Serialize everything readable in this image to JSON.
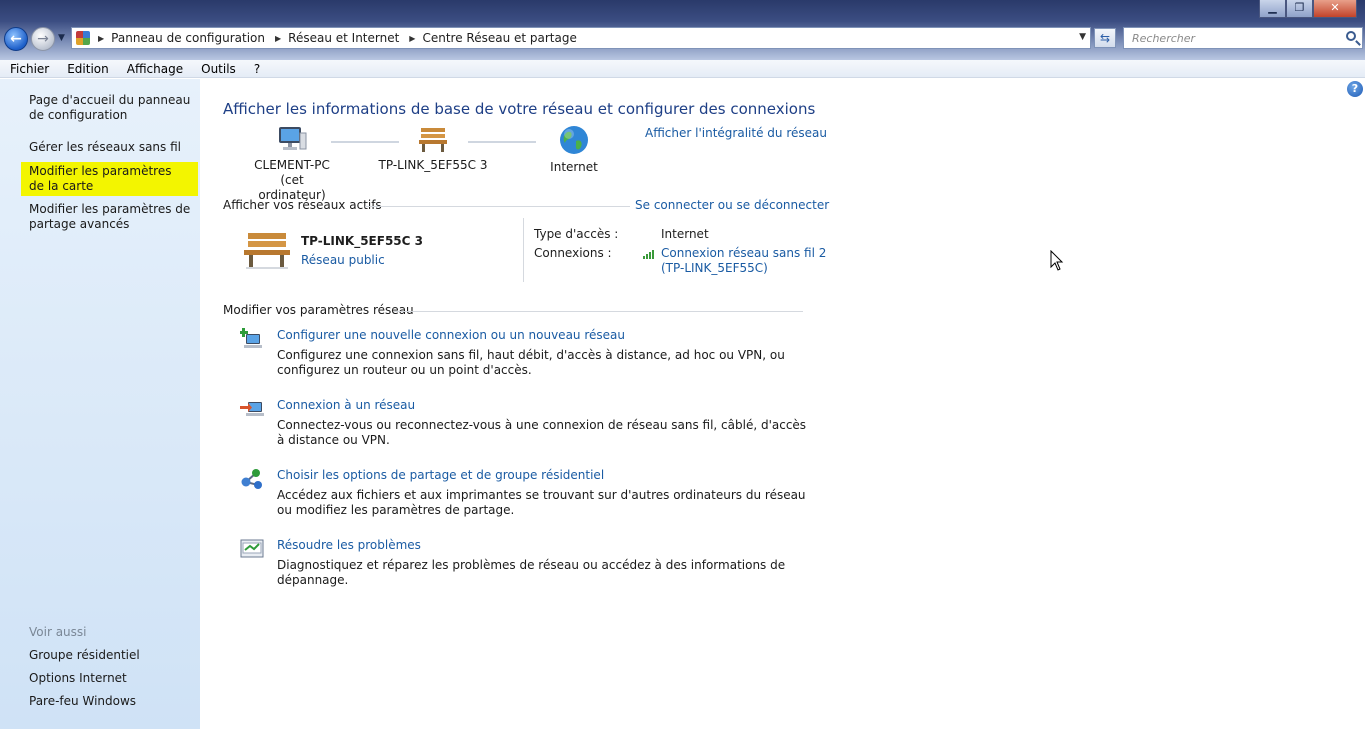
{
  "address": {
    "breadcrumbs": [
      "Panneau de configuration",
      "Réseau et Internet",
      "Centre Réseau et partage"
    ],
    "search_placeholder": "Rechercher"
  },
  "menu": [
    "Fichier",
    "Edition",
    "Affichage",
    "Outils",
    "?"
  ],
  "sidebar": {
    "links": [
      "Page d'accueil du panneau de configuration",
      "Gérer les réseaux sans fil",
      "Modifier les paramètres de la carte",
      "Modifier les paramètres de partage avancés"
    ],
    "see_also_title": "Voir aussi",
    "see_also": [
      "Groupe résidentiel",
      "Options Internet",
      "Pare-feu Windows"
    ]
  },
  "main": {
    "title": "Afficher les informations de base de votre réseau et configurer des connexions",
    "full_map_link": "Afficher l'intégralité du réseau",
    "map": {
      "computer_name": "CLEMENT-PC",
      "computer_sub": "(cet ordinateur)",
      "network_name": "TP-LINK_5EF55C  3",
      "internet": "Internet"
    },
    "active_networks_title": "Afficher vos réseaux actifs",
    "connect_link": "Se connecter ou se déconnecter",
    "active": {
      "name": "TP-LINK_5EF55C  3",
      "type": "Réseau public",
      "access_label": "Type d'accès :",
      "access_value": "Internet",
      "connections_label": "Connexions :",
      "connection_line1": "Connexion réseau sans fil 2",
      "connection_line2": "(TP-LINK_5EF55C)"
    },
    "settings_title": "Modifier vos paramètres réseau",
    "tasks": [
      {
        "link": "Configurer une nouvelle connexion ou un nouveau réseau",
        "desc": "Configurez une connexion sans fil, haut débit, d'accès à distance, ad hoc ou VPN, ou configurez un routeur ou un point d'accès."
      },
      {
        "link": "Connexion à un réseau",
        "desc": "Connectez-vous ou reconnectez-vous à une connexion de réseau sans fil, câblé, d'accès à distance ou VPN."
      },
      {
        "link": "Choisir les options de partage et de groupe résidentiel",
        "desc": "Accédez aux fichiers et aux imprimantes se trouvant sur d'autres ordinateurs du réseau ou modifiez les paramètres de partage."
      },
      {
        "link": "Résoudre les problèmes",
        "desc": "Diagnostiquez et réparez les problèmes de réseau ou accédez à des informations de dépannage."
      }
    ]
  },
  "colors": {
    "link": "#1a5ba3",
    "title": "#1e3f86",
    "sidebar": "#dceaf8",
    "highlight": "#f3f500"
  }
}
